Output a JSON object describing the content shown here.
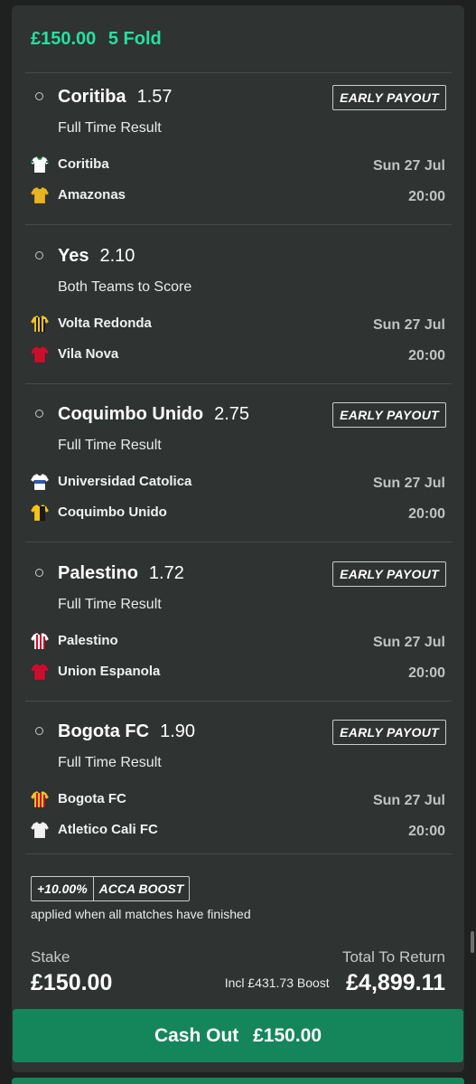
{
  "header": {
    "stake": "£150.00",
    "bet_type": "5 Fold"
  },
  "selections": [
    {
      "pick": "Coritiba",
      "odds": "1.57",
      "market": "Full Time Result",
      "early_payout": true,
      "home": "Coritiba",
      "away": "Amazonas",
      "date": "Sun 27 Jul",
      "time": "20:00",
      "home_kit": {
        "primary": "#ffffff",
        "secondary": "#1c7a3c",
        "pattern": "collar"
      },
      "away_kit": {
        "primary": "#e7b421",
        "secondary": "#1a1a1a",
        "pattern": "plain"
      }
    },
    {
      "pick": "Yes",
      "odds": "2.10",
      "market": "Both Teams to Score",
      "early_payout": false,
      "home": "Volta Redonda",
      "away": "Vila Nova",
      "date": "Sun 27 Jul",
      "time": "20:00",
      "home_kit": {
        "primary": "#f2c227",
        "secondary": "#1a1a1a",
        "pattern": "stripes"
      },
      "away_kit": {
        "primary": "#c8102e",
        "secondary": "#ffffff",
        "pattern": "plain"
      }
    },
    {
      "pick": "Coquimbo Unido",
      "odds": "2.75",
      "market": "Full Time Result",
      "early_payout": true,
      "home": "Universidad Catolica",
      "away": "Coquimbo Unido",
      "date": "Sun 27 Jul",
      "time": "20:00",
      "home_kit": {
        "primary": "#ffffff",
        "secondary": "#2a5db0",
        "pattern": "band"
      },
      "away_kit": {
        "primary": "#f3c41a",
        "secondary": "#1a1a1a",
        "pattern": "half"
      }
    },
    {
      "pick": "Palestino",
      "odds": "1.72",
      "market": "Full Time Result",
      "early_payout": true,
      "home": "Palestino",
      "away": "Union Espanola",
      "date": "Sun 27 Jul",
      "time": "20:00",
      "home_kit": {
        "primary": "#ffffff",
        "secondary": "#c8102e",
        "pattern": "stripes"
      },
      "away_kit": {
        "primary": "#c8102e",
        "secondary": "#c8102e",
        "pattern": "plain"
      }
    },
    {
      "pick": "Bogota FC",
      "odds": "1.90",
      "market": "Full Time Result",
      "early_payout": true,
      "home": "Bogota FC",
      "away": "Atletico Cali FC",
      "date": "Sun 27 Jul",
      "time": "20:00",
      "home_kit": {
        "primary": "#f2c227",
        "secondary": "#c8102e",
        "pattern": "stripes"
      },
      "away_kit": {
        "primary": "#f2f2f2",
        "secondary": "#f2f2f2",
        "pattern": "plain"
      }
    }
  ],
  "early_payout_label": "EARLY PAYOUT",
  "boost": {
    "percent": "+10.00%",
    "label": "ACCA BOOST",
    "note": "applied when all matches have finished"
  },
  "stake": {
    "label": "Stake",
    "value": "£150.00"
  },
  "returns": {
    "label": "Total To Return",
    "boost_text": "Incl £431.73 Boost",
    "value": "£4,899.11"
  },
  "cashout": {
    "label": "Cash Out",
    "amount": "£150.00"
  },
  "colors": {
    "accent": "#25e0a0",
    "cashout_bg": "#15855c",
    "card_bg": "#2f3332"
  }
}
